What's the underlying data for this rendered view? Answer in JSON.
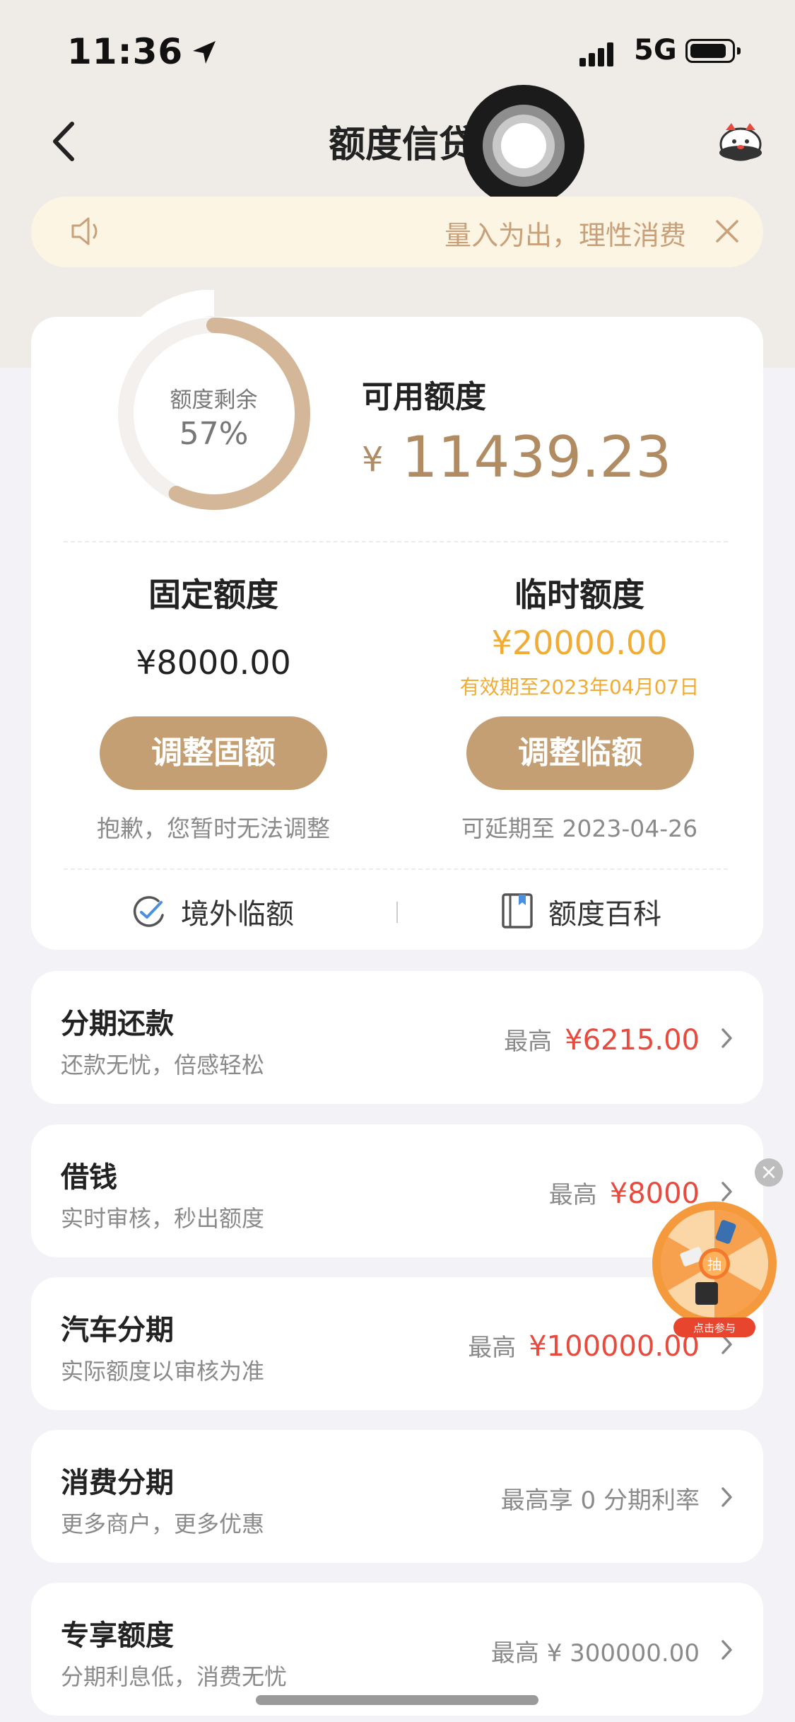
{
  "status_bar": {
    "time": "11:36",
    "network": "5G"
  },
  "nav": {
    "title": "额度信贷"
  },
  "notice": {
    "text": "量入为出，理性消费"
  },
  "credit": {
    "ring_label": "额度剩余",
    "ring_percent": "57%",
    "ring_fraction": 0.57,
    "available_label": "可用额度",
    "currency": "¥",
    "available_amount": "11439.23",
    "fixed": {
      "title": "固定额度",
      "amount": "¥8000.00",
      "button": "调整固额",
      "note": "抱歉，您暂时无法调整"
    },
    "temporary": {
      "title": "临时额度",
      "amount": "¥20000.00",
      "valid": "有效期至2023年04月07日",
      "button": "调整临额",
      "note": "可延期至 2023-04-26"
    },
    "links": {
      "overseas": "境外临额",
      "encyclopedia": "额度百科"
    }
  },
  "list": [
    {
      "title": "分期还款",
      "subtitle": "还款无忧，倍感轻松",
      "prefix": "最高",
      "value": "¥6215.00"
    },
    {
      "title": "借钱",
      "subtitle": "实时审核，秒出额度",
      "prefix": "最高",
      "value": "¥8000"
    },
    {
      "title": "汽车分期",
      "subtitle": "实际额度以审核为准",
      "prefix": "最高",
      "value": "¥100000.00"
    },
    {
      "title": "消费分期",
      "subtitle": "更多商户，更多优惠",
      "prefix": "最高享 0 分期利率",
      "value": ""
    },
    {
      "title": "专享额度",
      "subtitle": "分期利息低，消费无忧",
      "prefix": "最高 ¥ 300000.00",
      "value": ""
    }
  ],
  "lottery": {
    "center": "抽",
    "badge": "点击参与"
  },
  "colors": {
    "accent": "#c59f74",
    "amount": "#b18c63",
    "temp": "#f0ac34",
    "highlight": "#e84a3e"
  }
}
